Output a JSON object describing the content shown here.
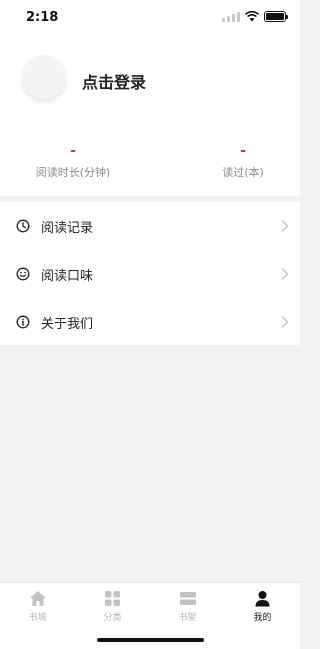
{
  "status_bar": {
    "time": "2:18"
  },
  "profile": {
    "login_label": "点击登录"
  },
  "stats": [
    {
      "value": "-",
      "label": "阅读时长(分钟)"
    },
    {
      "value": "-",
      "label": "读过(本)"
    }
  ],
  "menu": [
    {
      "label": "阅读记录",
      "icon": "clock-icon"
    },
    {
      "label": "阅读口味",
      "icon": "smile-icon"
    },
    {
      "label": "关于我们",
      "icon": "info-icon"
    }
  ],
  "tabs": [
    {
      "label": "书城",
      "icon": "home-icon"
    },
    {
      "label": "分类",
      "icon": "grid-icon"
    },
    {
      "label": "书架",
      "icon": "bookshelf-icon"
    },
    {
      "label": "我的",
      "icon": "person-icon"
    }
  ],
  "active_tab": "我的",
  "colors": {
    "accent": "#d9352b",
    "inactive": "#b5b5b5",
    "active": "#222222"
  }
}
